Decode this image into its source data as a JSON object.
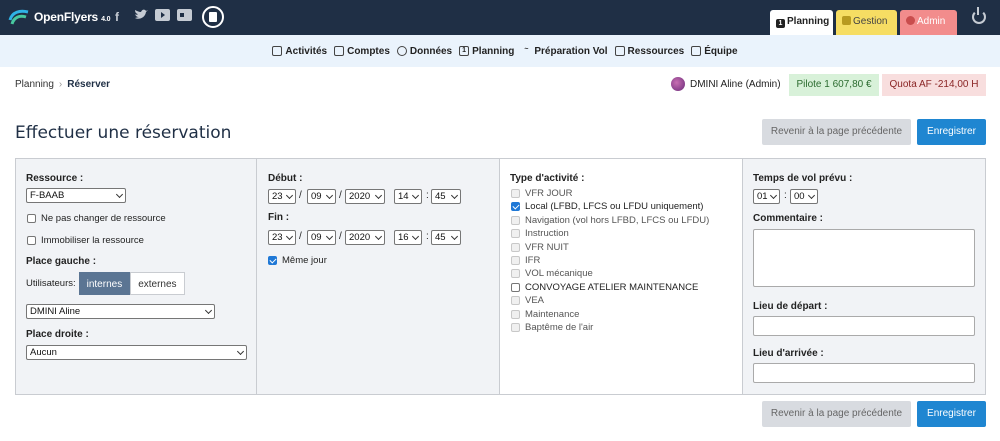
{
  "brand": {
    "name": "OpenFlyers",
    "version": "4.0"
  },
  "social": {
    "facebook": "f",
    "twitter": "twitter-icon",
    "youtube": "youtube-icon",
    "flickr": "flickr-icon"
  },
  "tabs": {
    "planning": "Planning",
    "gestion": "Gestion",
    "admin": "Admin"
  },
  "nav": [
    "Activités",
    "Comptes",
    "Données",
    "Planning",
    "Préparation Vol",
    "Ressources",
    "Équipe"
  ],
  "breadcrumb": {
    "root": "Planning",
    "sep": "›",
    "current": "Réserver"
  },
  "user": {
    "name": "DMINI Aline (Admin)",
    "balance": "Pilote 1 607,80 €",
    "quota": "Quota AF -214,00 H"
  },
  "page_title": "Effectuer une réservation",
  "buttons": {
    "back": "Revenir à la page précédente",
    "save": "Enregistrer"
  },
  "colors": {
    "topbar": "#1f2f45",
    "accent": "#1f86d1",
    "gestion": "#f6dd63",
    "admin": "#f28c8c"
  },
  "form": {
    "ressource_label": "Ressource :",
    "ressource_value": "F-BAAB",
    "keep_resource": "Ne pas changer de ressource",
    "immobilize": "Immobiliser la ressource",
    "place_gauche": "Place gauche :",
    "users_label": "Utilisateurs:",
    "internes": "internes",
    "externes": "externes",
    "left_user": "DMINI Aline",
    "place_droite": "Place droite :",
    "right_user": "Aucun",
    "debut_label": "Début :",
    "debut": {
      "day": "23",
      "month": "09",
      "year": "2020",
      "hour": "14",
      "minute": "45"
    },
    "fin_label": "Fin :",
    "fin": {
      "day": "23",
      "month": "09",
      "year": "2020",
      "hour": "16",
      "minute": "45"
    },
    "date_sep": "/",
    "time_sep": ":",
    "meme_jour": "Même jour",
    "activity_label": "Type d'activité :",
    "activities": [
      {
        "label": "VFR JOUR",
        "state": "disabled"
      },
      {
        "label": "Local (LFBD, LFCS ou LFDU uniquement)",
        "state": "checked"
      },
      {
        "label": "Navigation (vol hors LFBD, LFCS ou LFDU)",
        "state": "disabled"
      },
      {
        "label": "Instruction",
        "state": "disabled"
      },
      {
        "label": "VFR NUIT",
        "state": "disabled"
      },
      {
        "label": "IFR",
        "state": "disabled"
      },
      {
        "label": "VOL mécanique",
        "state": "disabled"
      },
      {
        "label": "CONVOYAGE ATELIER MAINTENANCE",
        "state": "unchecked"
      },
      {
        "label": "VEA",
        "state": "disabled"
      },
      {
        "label": "Maintenance",
        "state": "disabled"
      },
      {
        "label": "Baptême de l'air",
        "state": "disabled"
      }
    ],
    "flight_time_label": "Temps de vol prévu :",
    "flight_time": {
      "hours": "01",
      "minutes": "00"
    },
    "comment_label": "Commentaire :",
    "departure_label": "Lieu de départ :",
    "arrival_label": "Lieu d'arrivée :"
  }
}
